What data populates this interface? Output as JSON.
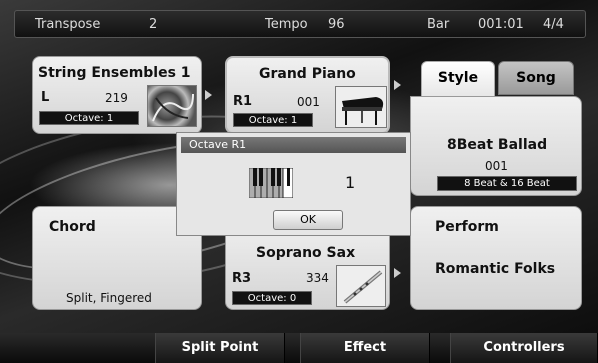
{
  "topbar": {
    "transpose_label": "Transpose",
    "transpose_value": "2",
    "tempo_label": "Tempo",
    "tempo_value": "96",
    "bar_label": "Bar",
    "bar_value": "001:01",
    "time_signature": "4/4"
  },
  "left_voice": {
    "name": "String Ensembles 1",
    "part": "L",
    "number": "219",
    "octave": "Octave: 1",
    "icon": "strings-image"
  },
  "right1_voice": {
    "name": "Grand Piano",
    "part": "R1",
    "number": "001",
    "octave": "Octave: 1",
    "icon": "grand-piano-image"
  },
  "right3_voice": {
    "name": "Soprano Sax",
    "part": "R3",
    "number": "334",
    "octave": "Octave: 0",
    "icon": "soprano-sax-image"
  },
  "chord": {
    "title": "Chord",
    "mode": "Split, Fingered"
  },
  "style": {
    "tabs": [
      "Style",
      "Song"
    ],
    "name": "8Beat Ballad",
    "number": "001",
    "category": "8 Beat & 16 Beat"
  },
  "perform": {
    "title": "Perform",
    "name": "Romantic Folks"
  },
  "dialog": {
    "title": "Octave R1",
    "value": "1",
    "ok_label": "OK",
    "icon": "keyboard-icon"
  },
  "bottombar": {
    "buttons": [
      "Split Point",
      "Effect",
      "Controllers"
    ]
  },
  "colors": {
    "card": "#e2e2e2",
    "tab_active": "#f0f0f0",
    "tab_inactive": "#a8a8a8",
    "octave_box": "#111111",
    "dialog_title": "#666666"
  }
}
